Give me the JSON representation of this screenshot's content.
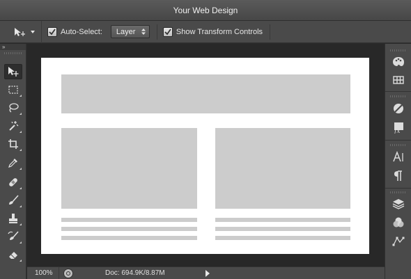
{
  "window": {
    "title": "Your Web Design"
  },
  "options_bar": {
    "auto_select_label": "Auto-Select:",
    "auto_select_checked": true,
    "target_value": "Layer",
    "show_transform_label": "Show Transform Controls",
    "show_transform_checked": true
  },
  "tools": [
    {
      "name": "move-tool",
      "icon": "move-icon",
      "active": true
    },
    {
      "name": "marquee-tool",
      "icon": "marquee-icon"
    },
    {
      "name": "lasso-tool",
      "icon": "lasso-icon"
    },
    {
      "name": "magic-wand-tool",
      "icon": "magic-wand-icon"
    },
    {
      "name": "crop-tool",
      "icon": "crop-icon"
    },
    {
      "name": "eyedropper-tool",
      "icon": "eyedropper-icon"
    },
    {
      "name": "healing-tool",
      "icon": "bandage-icon"
    },
    {
      "name": "brush-tool",
      "icon": "brush-icon"
    },
    {
      "name": "stamp-tool",
      "icon": "stamp-icon"
    },
    {
      "name": "history-brush-tool",
      "icon": "history-brush-icon"
    },
    {
      "name": "eraser-tool",
      "icon": "eraser-icon"
    }
  ],
  "right_panel_icons": [
    "palette-icon",
    "swatches-icon",
    "adjustments-icon",
    "styles-icon",
    "character-icon",
    "paragraph-icon",
    "layers-icon",
    "channels-icon",
    "paths-icon"
  ],
  "status": {
    "zoom": "100%",
    "doc_info": "Doc: 694.9K/8.87M"
  },
  "colors": {
    "panel": "#4a4a4a",
    "workspace": "#282828",
    "placeholder": "#cccccc",
    "canvas": "#ffffff"
  }
}
